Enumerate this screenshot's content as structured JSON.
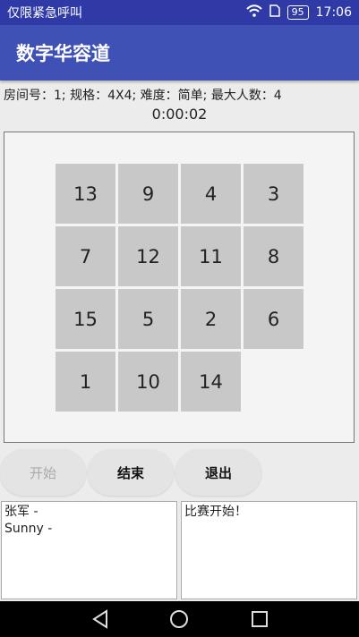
{
  "status": {
    "carrier": "仅限紧急呼叫",
    "battery": "95",
    "time": "17:06"
  },
  "app": {
    "title": "数字华容道"
  },
  "room": {
    "info": "房间号：1; 规格：4X4; 难度：简单; 最大人数：4",
    "timer": "0:00:02"
  },
  "board": {
    "size": 4,
    "tiles": [
      [
        "13",
        "9",
        "4",
        "3"
      ],
      [
        "7",
        "12",
        "11",
        "8"
      ],
      [
        "15",
        "5",
        "2",
        "6"
      ],
      [
        "1",
        "10",
        "14",
        ""
      ]
    ]
  },
  "buttons": {
    "start": "开始",
    "end": "结束",
    "exit": "退出"
  },
  "players": {
    "lines": [
      "张军 -",
      "Sunny -"
    ]
  },
  "messages": {
    "lines": [
      "比赛开始！"
    ]
  }
}
